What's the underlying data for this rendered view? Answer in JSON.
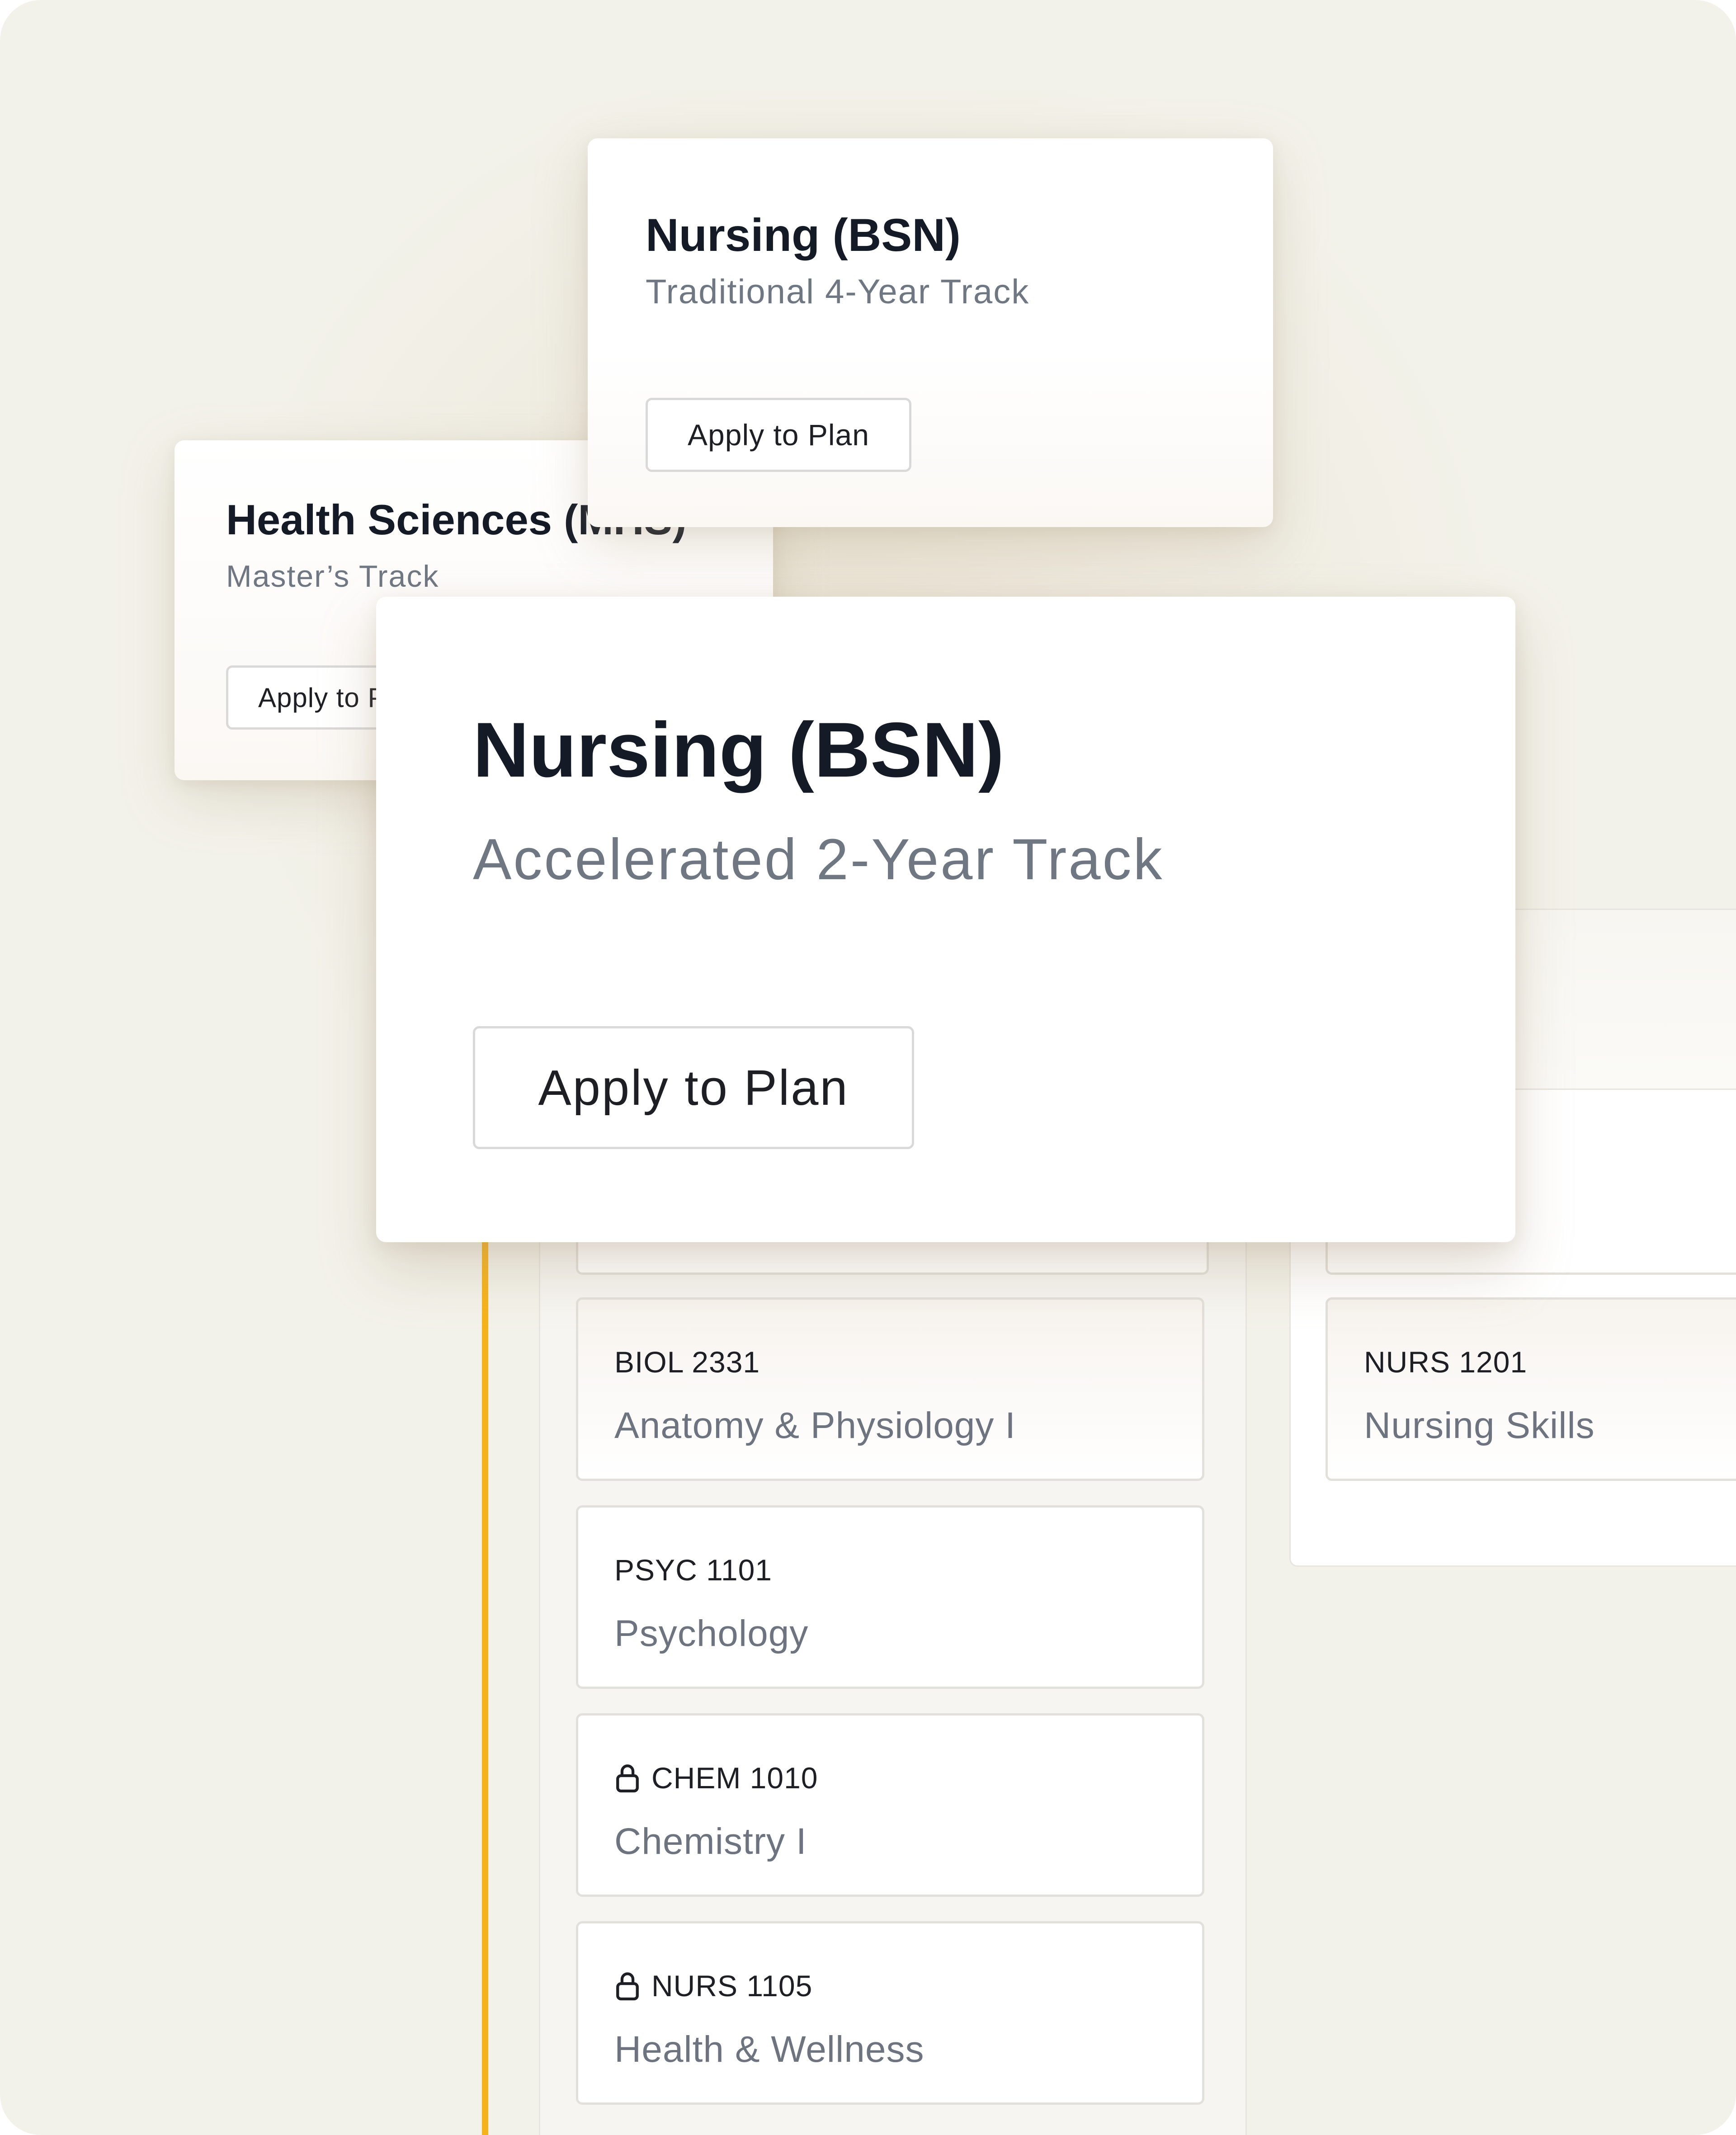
{
  "programs": {
    "health_sciences": {
      "title": "Health Sciences (MHS)",
      "subtitle": "Master’s Track",
      "button": "Apply to Plan"
    },
    "nursing_traditional": {
      "title": "Nursing (BSN)",
      "subtitle": "Traditional 4-Year Track",
      "button": "Apply to Plan"
    },
    "nursing_accelerated": {
      "title": "Nursing (BSN)",
      "subtitle": "Accelerated 2-Year Track",
      "button": "Apply to Plan"
    }
  },
  "columns": {
    "left": {
      "accent_color": "#f6b21a",
      "courses": [
        {
          "code": "BIOL 2331",
          "title": "Anatomy & Physiology I",
          "locked": false
        },
        {
          "code": "PSYC 1101",
          "title": "Psychology",
          "locked": false
        },
        {
          "code": "CHEM 1010",
          "title": "Chemistry I",
          "locked": true,
          "icon": "lock-icon"
        },
        {
          "code": "NURS 1105",
          "title": "Health & Wellness",
          "locked": true,
          "icon": "lock-icon"
        }
      ]
    },
    "right": {
      "courses": [
        {
          "code": "NURS 1201",
          "title": "Nursing Skills",
          "locked": false
        }
      ]
    }
  }
}
